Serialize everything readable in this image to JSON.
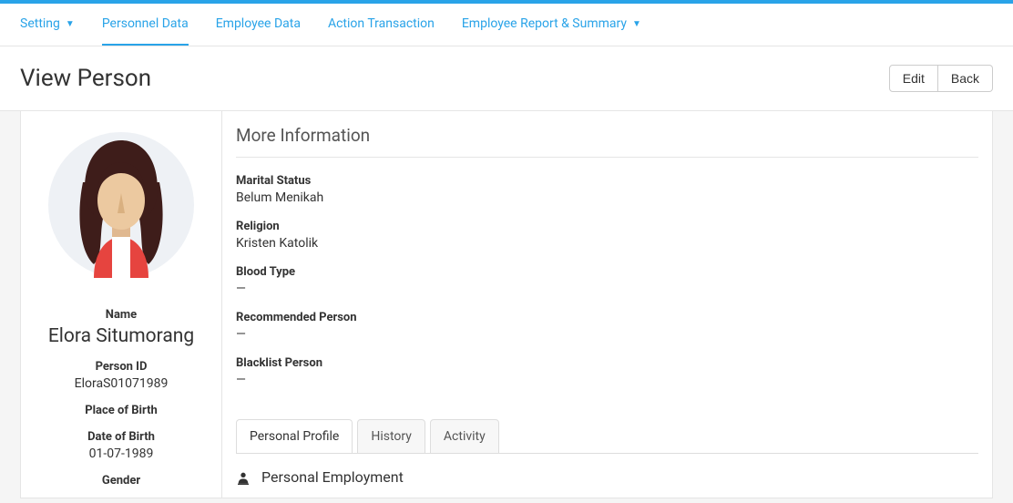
{
  "nav": {
    "items": [
      {
        "label": "Setting",
        "has_caret": true,
        "active": false
      },
      {
        "label": "Personnel Data",
        "has_caret": false,
        "active": true
      },
      {
        "label": "Employee Data",
        "has_caret": false,
        "active": false
      },
      {
        "label": "Action Transaction",
        "has_caret": false,
        "active": false
      },
      {
        "label": "Employee Report & Summary",
        "has_caret": true,
        "active": false
      }
    ]
  },
  "header": {
    "title": "View Person",
    "edit_label": "Edit",
    "back_label": "Back"
  },
  "sidebar": {
    "name_label": "Name",
    "name_value": "Elora Situmorang",
    "person_id_label": "Person ID",
    "person_id_value": "EloraS01071989",
    "pob_label": "Place of Birth",
    "pob_value": "",
    "dob_label": "Date of Birth",
    "dob_value": "01-07-1989",
    "gender_label": "Gender"
  },
  "more_info": {
    "heading": "More Information",
    "marital_status_label": "Marital Status",
    "marital_status_value": "Belum Menikah",
    "religion_label": "Religion",
    "religion_value": "Kristen Katolik",
    "blood_type_label": "Blood Type",
    "blood_type_value": "—",
    "recommended_label": "Recommended Person",
    "recommended_value": "—",
    "blacklist_label": "Blacklist Person",
    "blacklist_value": "—"
  },
  "tabs": {
    "items": [
      {
        "label": "Personal Profile",
        "active": true
      },
      {
        "label": "History",
        "active": false
      },
      {
        "label": "Activity",
        "active": false
      }
    ],
    "panel_heading": "Personal Employment"
  }
}
